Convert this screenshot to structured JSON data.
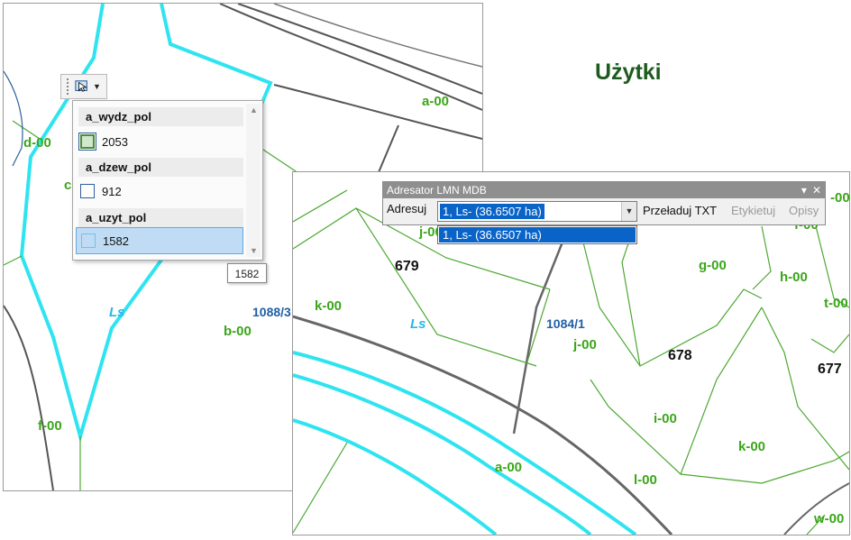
{
  "slide": {
    "title": "Użytki"
  },
  "map1": {
    "labels": {
      "a00": "a-00",
      "d00": "d-00",
      "c": "c",
      "ls": "Ls",
      "num": "1088/3",
      "b00": "b-00",
      "f00": "f-00"
    }
  },
  "map2": {
    "labels": {
      "p679": "679",
      "k00a": "k-00",
      "ls": "Ls",
      "num": "1084/1",
      "j00a": "j-00",
      "j00b": "j-00",
      "p678": "678",
      "g00": "g-00",
      "h00": "h-00",
      "t00": "t-00",
      "p677": "677",
      "i00": "i-00",
      "k00b": "k-00",
      "a00": "a-00",
      "l00": "l-00",
      "w00": "w-00",
      "d00r": "-00",
      "f00r": "f-00"
    }
  },
  "selection_tool": {
    "icon": "select-features-icon",
    "groups": [
      {
        "layer": "a_wydz_pol",
        "value": "2053",
        "swatch": "green"
      },
      {
        "layer": "a_dzew_pol",
        "value": "912",
        "swatch": "blue"
      },
      {
        "layer": "a_uzyt_pol",
        "value": "1582",
        "swatch": "light"
      }
    ],
    "tooltip": "1582"
  },
  "adresator": {
    "title": "Adresator LMN MDB",
    "label": "Adresuj",
    "combo_value": "1, Ls- (36.6507 ha)",
    "reload": "Przeładuj TXT",
    "label_btn": "Etykietuj",
    "desc_btn": "Opisy",
    "list_option": "1, Ls- (36.6507 ha)"
  },
  "colors": {
    "title": "#1e5b1e",
    "green_label": "#3aa619",
    "blue_label": "#1f5fa6",
    "cyan_line": "#2ee4f0",
    "selection": "#0a64c8"
  }
}
